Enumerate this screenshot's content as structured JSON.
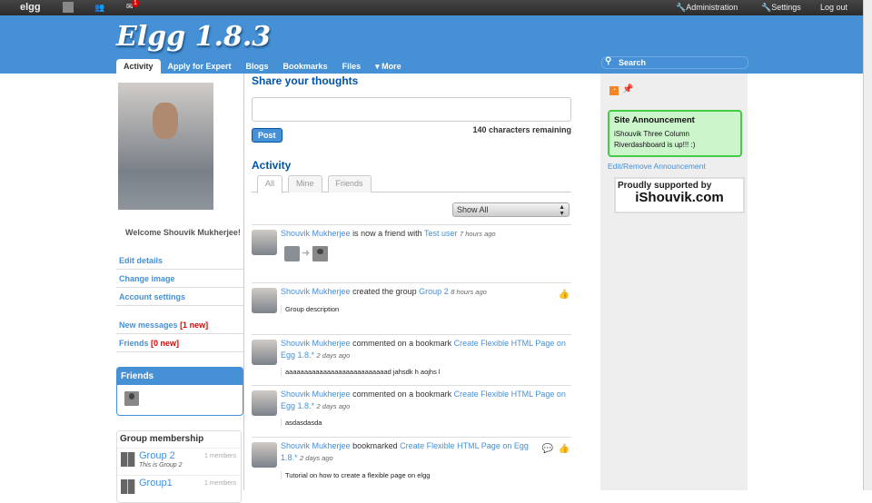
{
  "topbar": {
    "logo": "elgg",
    "messages_badge": "1",
    "administration": "Administration",
    "settings": "Settings",
    "logout": "Log out"
  },
  "header": {
    "site_title": "Elgg 1.8.3",
    "search_placeholder": "Search"
  },
  "nav": {
    "tabs": [
      {
        "label": "Activity"
      },
      {
        "label": "Apply for Expert"
      },
      {
        "label": "Blogs"
      },
      {
        "label": "Bookmarks"
      },
      {
        "label": "Files"
      },
      {
        "label": "▾ More"
      }
    ]
  },
  "left": {
    "welcome": "Welcome Shouvik Mukherjee!",
    "links": {
      "edit_details": "Edit details",
      "change_image": "Change image",
      "account_settings": "Account settings",
      "new_messages": "New messages",
      "new_messages_count": "[1 new]",
      "friends": "Friends",
      "friends_count": "[0 new]"
    },
    "friends_title": "Friends",
    "groups_title": "Group membership",
    "groups": [
      {
        "name": "Group 2",
        "desc": "This is Group 2",
        "members": "1 members"
      },
      {
        "name": "Group1",
        "desc": "",
        "members": "1 members"
      }
    ]
  },
  "main": {
    "share_title": "Share your thoughts",
    "post": "Post",
    "chars_remaining": "140 characters remaining",
    "activity_title": "Activity",
    "filters": [
      "All",
      "Mine",
      "Friends"
    ],
    "show_all": "Show All",
    "items": [
      {
        "user": "Shouvik Mukherjee",
        "action": "is now a friend with",
        "target": "Test user",
        "target2": "",
        "time": "7 hours ago",
        "body": ""
      },
      {
        "user": "Shouvik Mukherjee",
        "action": "created the group",
        "target": "Group 2",
        "target2": "",
        "time": "8 hours ago",
        "body": "Group description"
      },
      {
        "user": "Shouvik Mukherjee",
        "action": "commented on a bookmark",
        "target": "Create Flexible HTML Page on Egg 1.8.*",
        "time": "2 days ago",
        "body": "aaaaaaaaaaaaaaaaaaaaaaaaaaad jahsdk h aojhs l"
      },
      {
        "user": "Shouvik Mukherjee",
        "action": "commented on a bookmark",
        "target": "Create Flexible HTML Page on Egg 1.8.*",
        "time": "2 days ago",
        "body": "asdasdasda"
      },
      {
        "user": "Shouvik Mukherjee",
        "action": "bookmarked",
        "target": "Create Flexible HTML Page on Egg 1.8.*",
        "time": "2 days ago",
        "body": "Tutorial on how to create a flexible page on elgg"
      }
    ]
  },
  "right": {
    "announcement_title": "Site Announcement",
    "announcement_body": "iShouvik Three Column Riverdashboard is up!!! :)",
    "edit_announcement": "Edit/Remove Announcement",
    "ad_line1": "Proudly supported by",
    "ad_line2": "iShouvik.com"
  }
}
